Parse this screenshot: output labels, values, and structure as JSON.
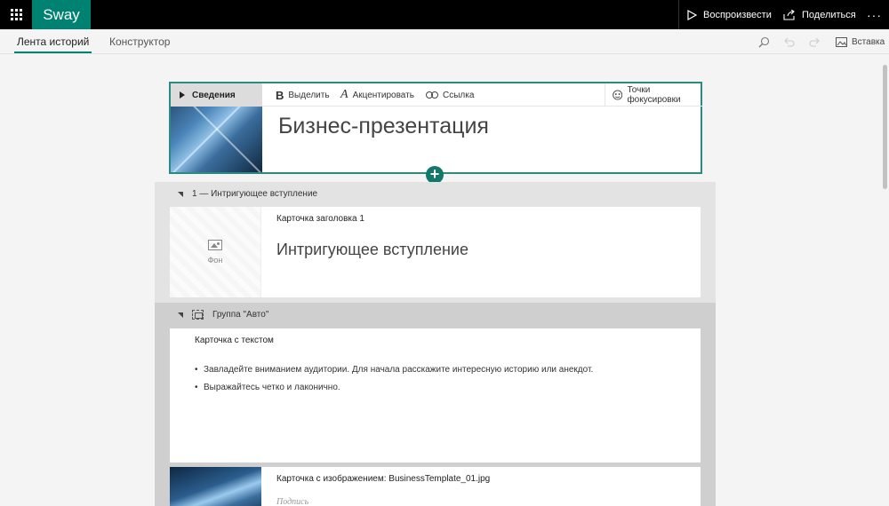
{
  "app": {
    "brand": "Sway",
    "play_label": "Воспроизвести",
    "share_label": "Поделиться",
    "more_label": "···"
  },
  "nav": {
    "tabs": [
      {
        "label": "Лента историй",
        "active": true
      },
      {
        "label": "Конструктор",
        "active": false
      }
    ],
    "insert_label": "Вставка"
  },
  "title_card": {
    "details_label": "Сведения",
    "toolbar": {
      "bold_label": "Выделить",
      "accent_label": "Акцентировать",
      "link_label": "Ссылка",
      "focus_label": "Точки фокусировки"
    },
    "title": "Бизнес-презентация"
  },
  "sections": [
    {
      "heading": "1 — Интригующее вступление",
      "card_label": "Карточка заголовка 1",
      "background_label": "Фон",
      "text": "Интригующее вступление"
    },
    {
      "heading": "Группа \"Авто\"",
      "text_card_label": "Карточка с текстом",
      "bullets": [
        "Завладейте вниманием аудитории.  Для начала расскажите интересную историю или анекдот.",
        "Выражайтесь четко и лаконично."
      ],
      "image_card_label": "Карточка с изображением: BusinessTemplate_01.jpg",
      "caption_placeholder": "Подпись"
    }
  ],
  "colors": {
    "accent": "#008272",
    "card_border": "#2c8a82",
    "topbar": "#000000"
  }
}
